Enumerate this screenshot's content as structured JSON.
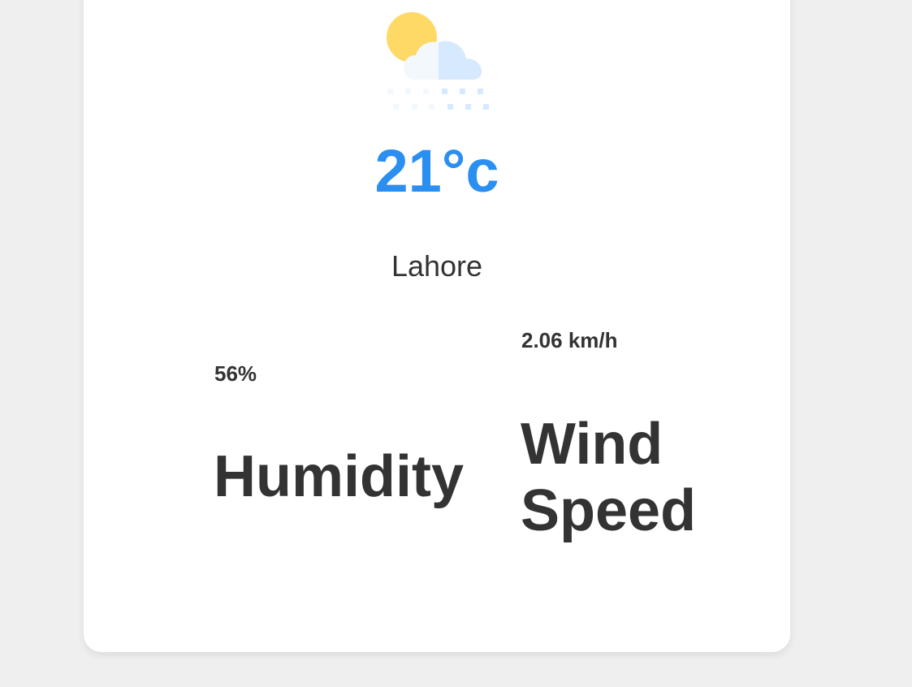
{
  "weather": {
    "icon": "sun-cloud-snow-icon",
    "temperature": "21°c",
    "city": "Lahore"
  },
  "details": {
    "humidity_value": "56%",
    "humidity_label": "Humidity",
    "wind_value": "2.06 km/h",
    "wind_label": "Wind Speed"
  },
  "colors": {
    "background": "#efefef",
    "card": "#ffffff",
    "temperature": "#2a8ff0",
    "text": "#333333",
    "sun": "#ffd966",
    "cloud": "#d6e9ff"
  }
}
